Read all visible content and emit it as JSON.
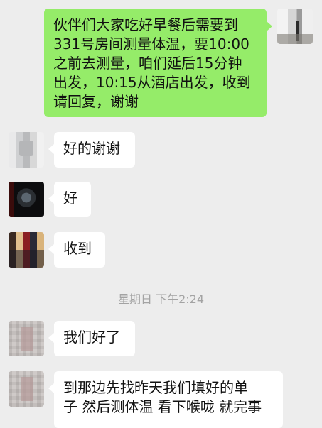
{
  "messages": [
    {
      "side": "out",
      "lines": [
        "伙伴们大家吃好早餐后需要到",
        "331号房间测量体温，要10:00",
        "之前去测量，咱们延后15分钟",
        "出发，10:15从酒店出发，收到",
        "请回复，谢谢"
      ]
    },
    {
      "side": "in",
      "lines": [
        "好的谢谢"
      ]
    },
    {
      "side": "in",
      "lines": [
        "好"
      ]
    },
    {
      "side": "in",
      "lines": [
        "收到"
      ]
    },
    {
      "side": "in",
      "lines": [
        "我们好了"
      ]
    },
    {
      "side": "in",
      "lines": [
        "到那边先找昨天我们填好的单",
        "子 然后测体温 看下喉咙 就完事"
      ]
    }
  ],
  "timestamp": "星期日 下午2:24",
  "colors": {
    "background": "#ededed",
    "outgoing_bubble": "#95ec69",
    "incoming_bubble": "#ffffff",
    "timestamp_text": "#a3a3a3"
  }
}
